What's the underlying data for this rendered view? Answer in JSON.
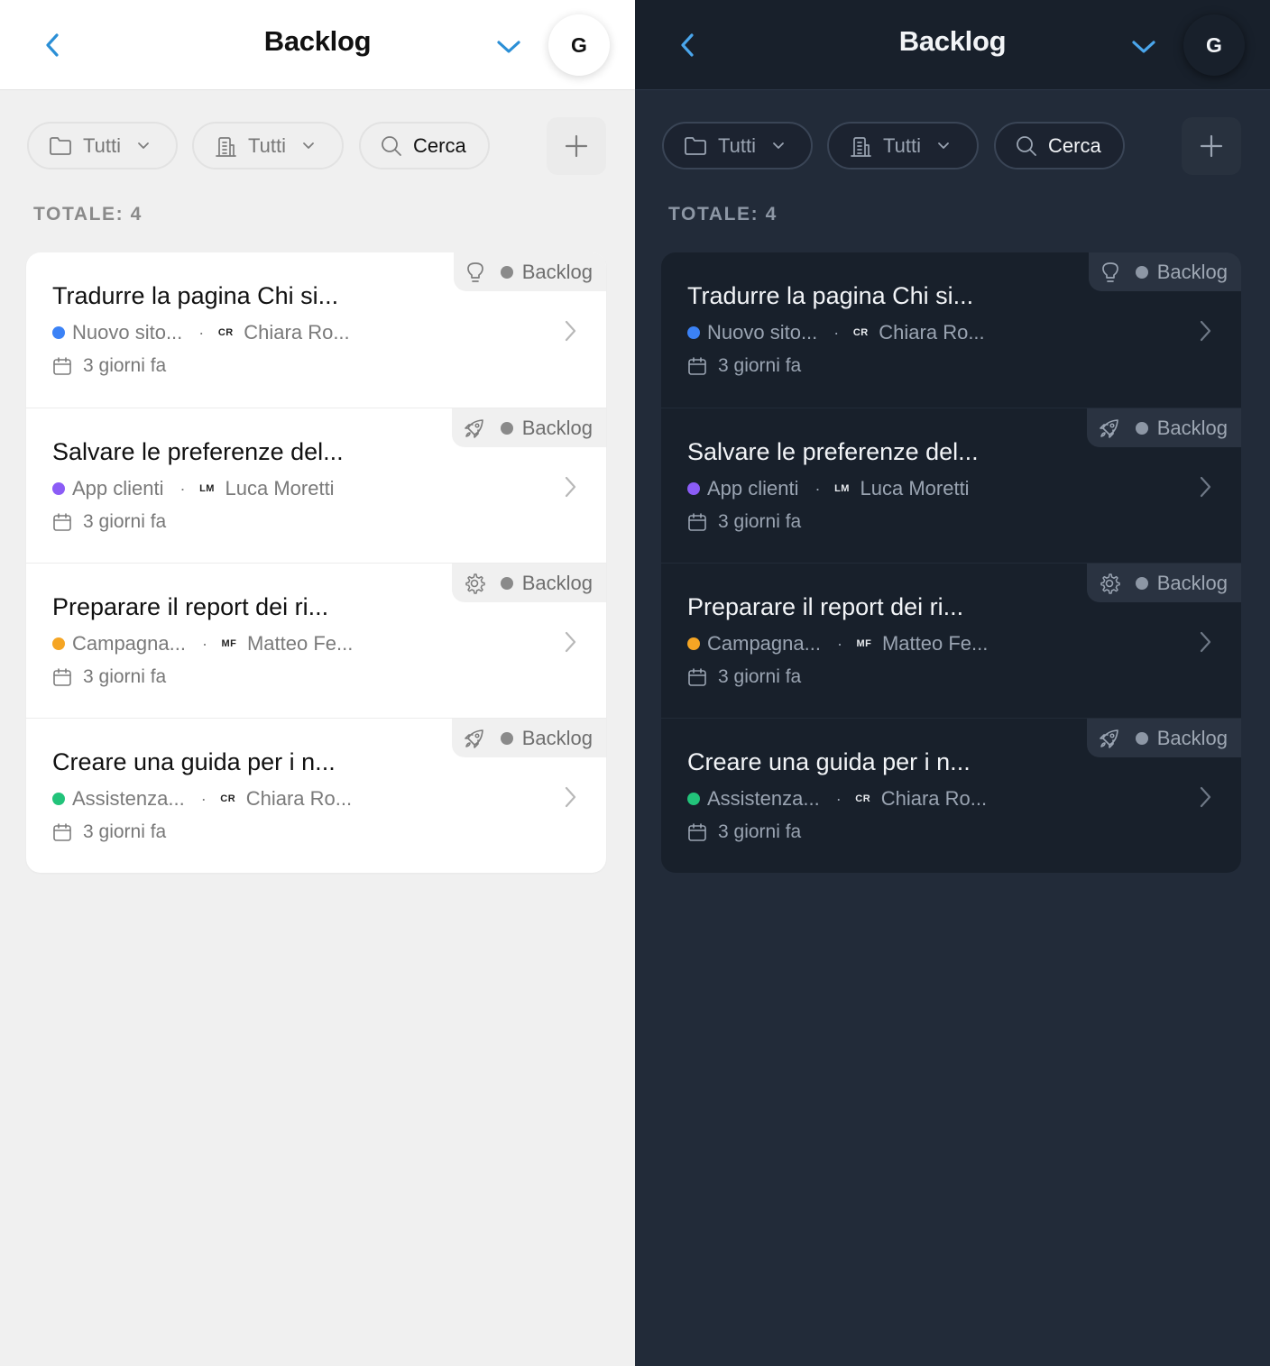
{
  "colors": {
    "accent": "#2b8fd6",
    "accent_dark": "#4aa6ec",
    "light_bg": "#f0f0f0",
    "dark_bg": "#222b39",
    "project_blue": "#3b82f6",
    "project_purple": "#8b5cf6",
    "project_orange": "#f5a524",
    "project_green": "#22c37a"
  },
  "header": {
    "title": "Backlog",
    "back_icon": "chevron-left-icon",
    "dropdown_icon": "chevron-down-icon",
    "avatar_initial": "G"
  },
  "toolbar": {
    "folder_filter": {
      "icon": "folder-icon",
      "label": "Tutti"
    },
    "building_filter": {
      "icon": "building-icon",
      "label": "Tutti"
    },
    "search": {
      "icon": "search-icon",
      "label": "Cerca"
    },
    "add_icon": "plus-icon"
  },
  "total_label": "TOTALE: 4",
  "tasks": [
    {
      "title": "Tradurre la pagina Chi si...",
      "type_icon": "lightbulb-icon",
      "status": "Backlog",
      "project": "Nuovo sito...",
      "project_color": "#3b82f6",
      "assignee_initials": "CR",
      "assignee": "Chiara Ro...",
      "date": "3 giorni fa"
    },
    {
      "title": "Salvare le preferenze del...",
      "type_icon": "rocket-icon",
      "status": "Backlog",
      "project": "App clienti",
      "project_color": "#8b5cf6",
      "assignee_initials": "LM",
      "assignee": "Luca Moretti",
      "date": "3 giorni fa"
    },
    {
      "title": "Preparare il report dei ri...",
      "type_icon": "gear-icon",
      "status": "Backlog",
      "project": "Campagna...",
      "project_color": "#f5a524",
      "assignee_initials": "MF",
      "assignee": "Matteo Fe...",
      "date": "3 giorni fa"
    },
    {
      "title": "Creare una guida per i n...",
      "type_icon": "rocket-icon",
      "status": "Backlog",
      "project": "Assistenza...",
      "project_color": "#22c37a",
      "assignee_initials": "CR",
      "assignee": "Chiara Ro...",
      "date": "3 giorni fa"
    }
  ]
}
